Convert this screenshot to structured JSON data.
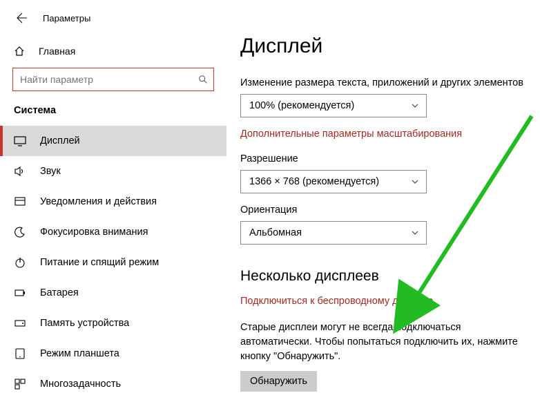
{
  "window": {
    "title": "Параметры"
  },
  "sidebar": {
    "home_label": "Главная",
    "search_placeholder": "Найти параметр",
    "section_title": "Система",
    "items": [
      {
        "label": "Дисплей"
      },
      {
        "label": "Звук"
      },
      {
        "label": "Уведомления и действия"
      },
      {
        "label": "Фокусировка внимания"
      },
      {
        "label": "Питание и спящий режим"
      },
      {
        "label": "Батарея"
      },
      {
        "label": "Память устройства"
      },
      {
        "label": "Режим планшета"
      },
      {
        "label": "Многозадачность"
      }
    ]
  },
  "main": {
    "title": "Дисплей",
    "scale_label": "Изменение размера текста, приложений и других элементов",
    "scale_value": "100% (рекомендуется)",
    "scale_link": "Дополнительные параметры масштабирования",
    "resolution_label": "Разрешение",
    "resolution_value": "1366 × 768 (рекомендуется)",
    "orientation_label": "Ориентация",
    "orientation_value": "Альбомная",
    "multi_heading": "Несколько дисплеев",
    "wireless_link": "Подключиться к беспроводному дисплею",
    "old_desc": "Старые дисплеи могут не всегда подключаться автоматически. Чтобы попытаться подключить их, нажмите кнопку \"Обнаружить\".",
    "detect_btn": "Обнаружить"
  }
}
